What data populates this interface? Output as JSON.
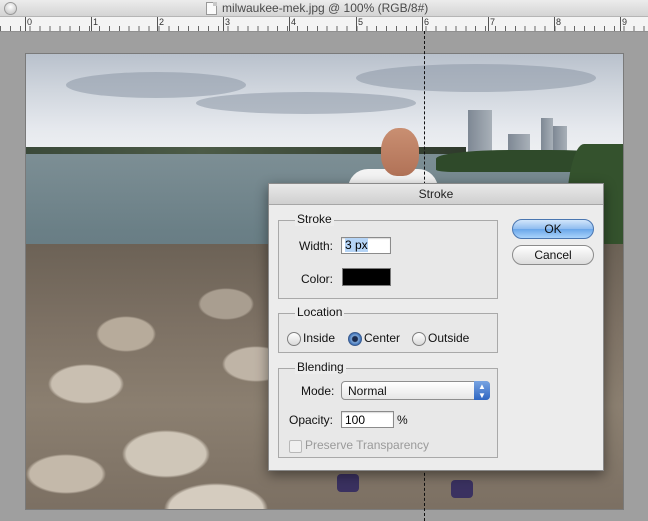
{
  "window": {
    "title": "milwaukee-mek.jpg @ 100% (RGB/8#)"
  },
  "ruler": {
    "labels": [
      "0",
      "1",
      "2",
      "3",
      "4",
      "5",
      "6",
      "7",
      "8",
      "9"
    ]
  },
  "dialog": {
    "title": "Stroke",
    "stroke_group": {
      "legend": "Stroke",
      "width_label": "Width:",
      "width_value": "3 px",
      "color_label": "Color:",
      "color_value": "#000000"
    },
    "location_group": {
      "legend": "Location",
      "options": [
        "Inside",
        "Center",
        "Outside"
      ],
      "selected": "Center"
    },
    "blending_group": {
      "legend": "Blending",
      "mode_label": "Mode:",
      "mode_value": "Normal",
      "opacity_label": "Opacity:",
      "opacity_value": "100",
      "opacity_unit": "%",
      "preserve_label": "Preserve Transparency",
      "preserve_checked": false
    },
    "buttons": {
      "ok": "OK",
      "cancel": "Cancel"
    }
  },
  "colors": {
    "accent": "#6aa6ea",
    "swatch": "#000000"
  }
}
